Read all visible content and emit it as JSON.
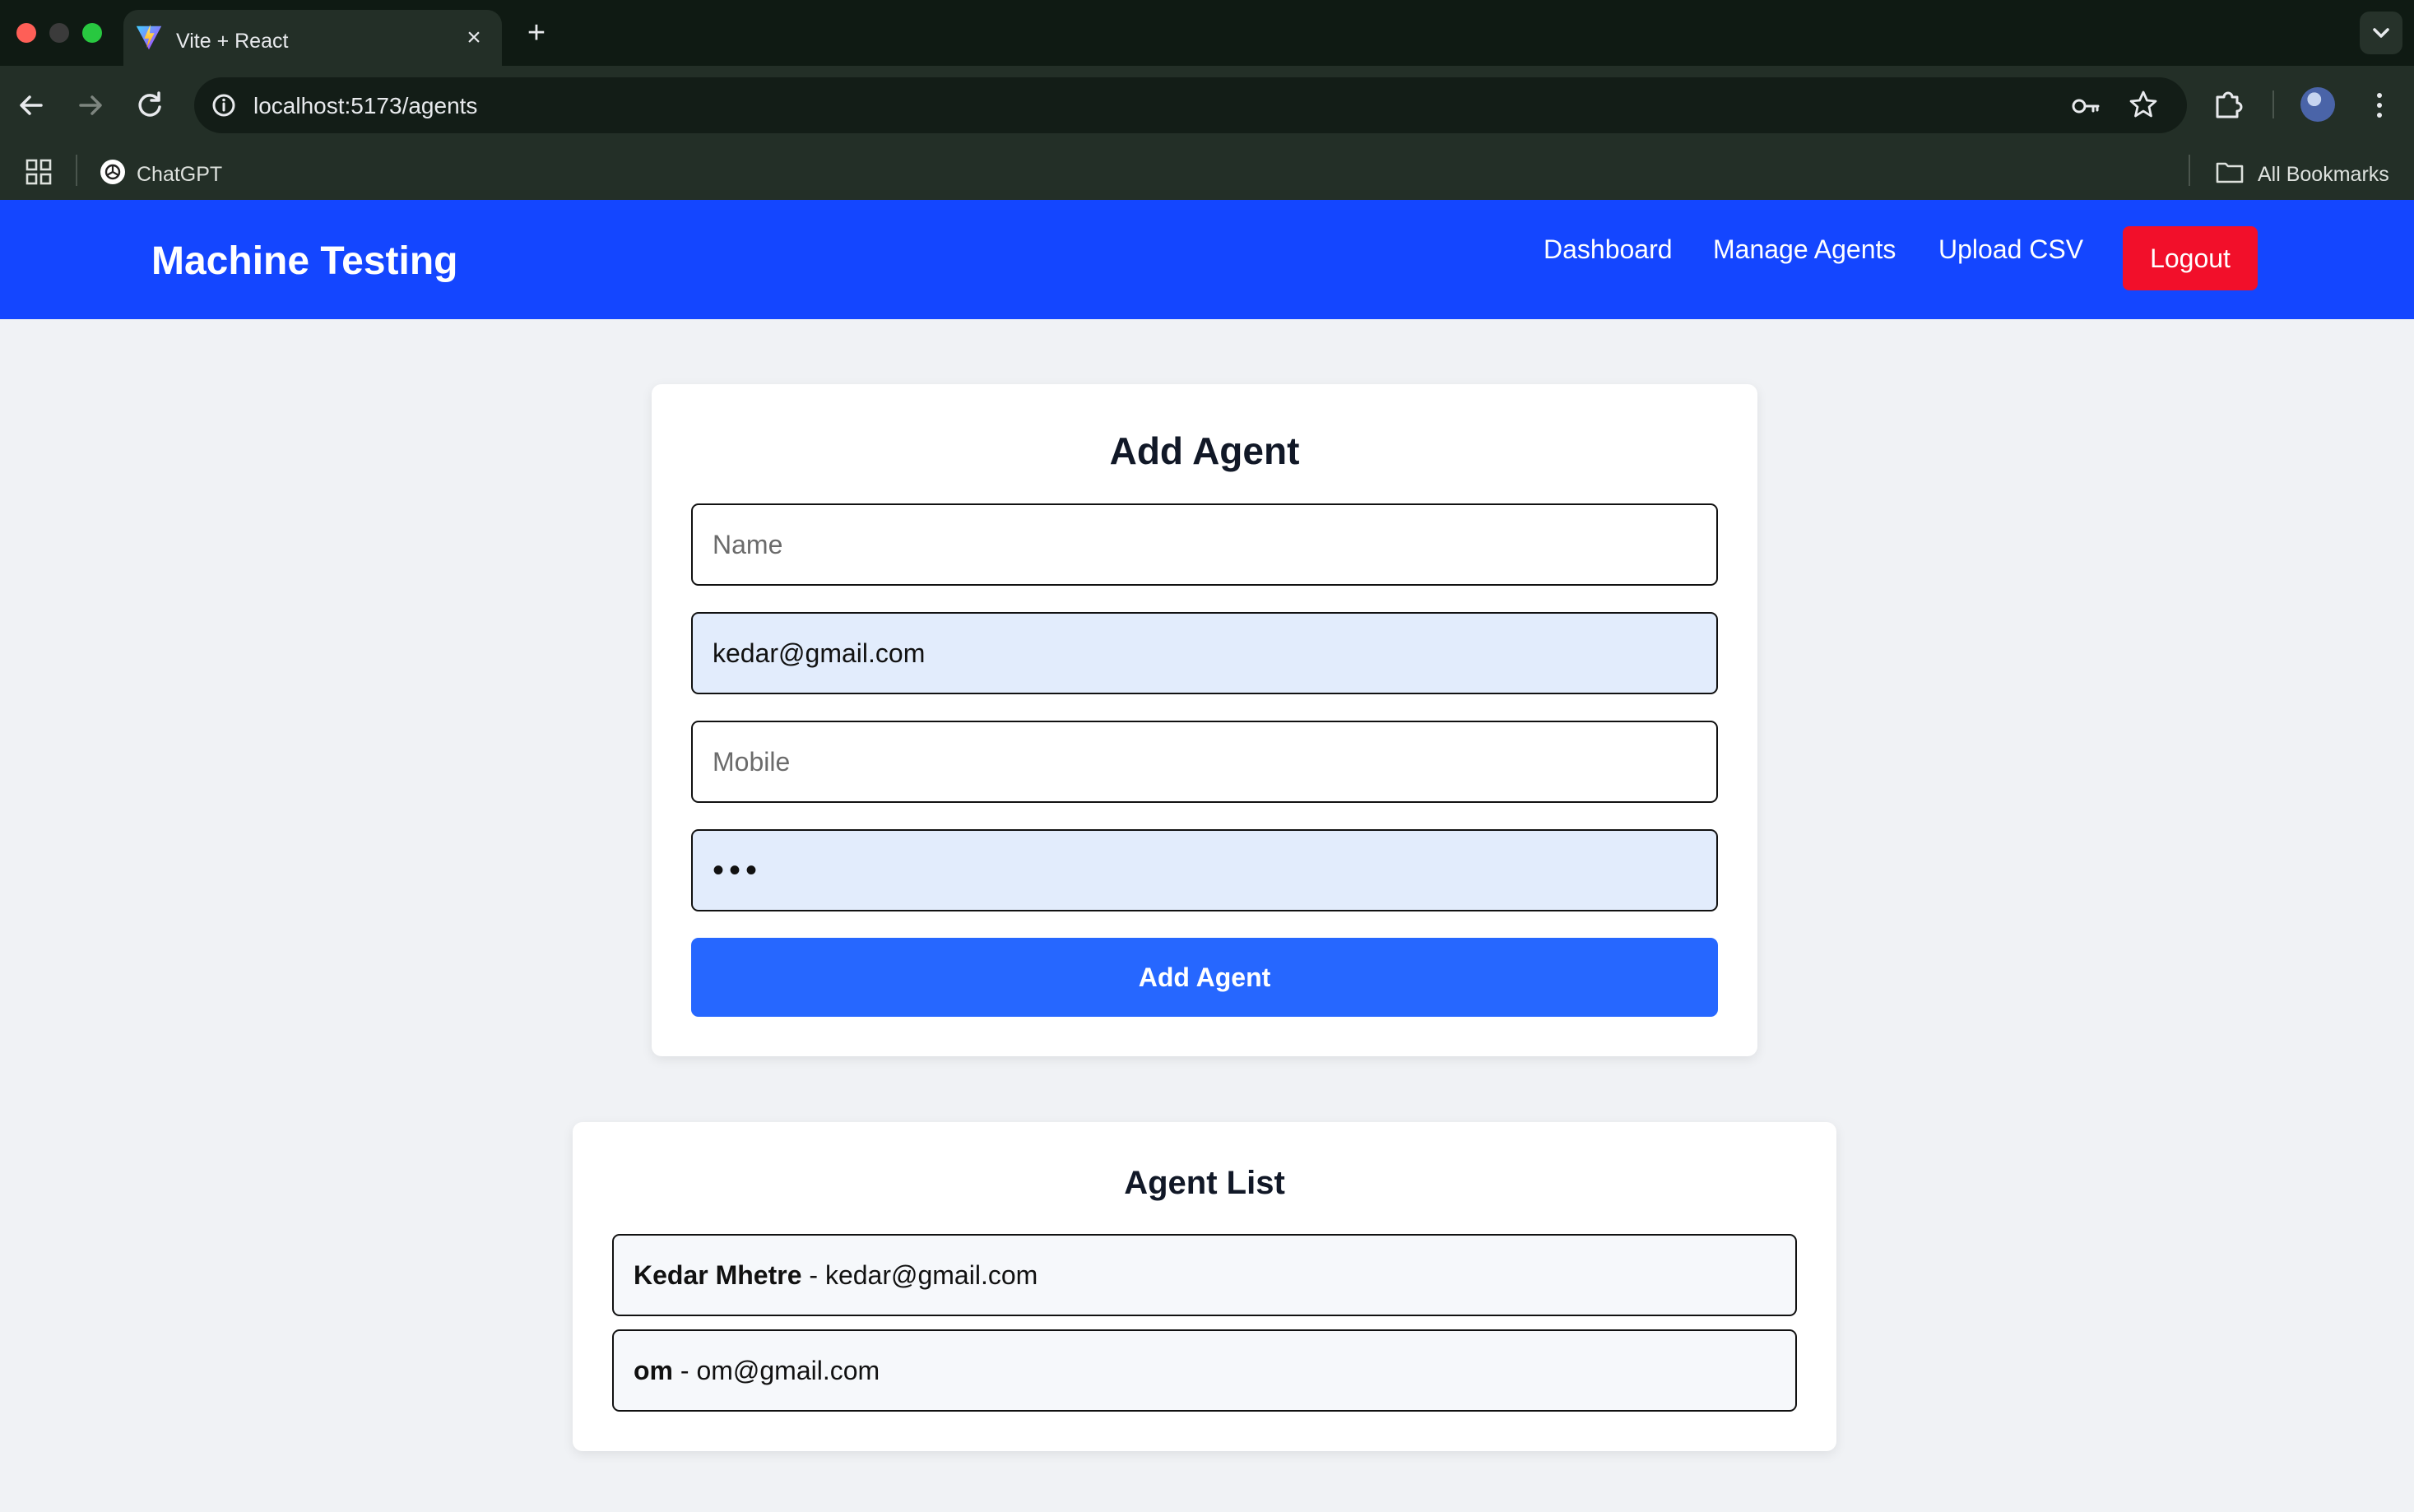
{
  "browser": {
    "tab_title": "Vite + React",
    "tab_close": "×",
    "new_tab": "+",
    "url": "localhost:5173/agents",
    "bookmarks": [
      {
        "label": "ChatGPT"
      }
    ],
    "all_bookmarks": "All Bookmarks"
  },
  "navbar": {
    "brand": "Machine Testing",
    "links": [
      "Dashboard",
      "Manage Agents",
      "Upload CSV"
    ],
    "logout": "Logout",
    "bg_color": "#1446ff",
    "logout_color": "#f20f2a"
  },
  "add_agent": {
    "title": "Add Agent",
    "name_placeholder": "Name",
    "email_value": "kedar@gmail.com",
    "mobile_placeholder": "Mobile",
    "password_value": "•••",
    "submit_label": "Add Agent",
    "button_color": "#2667ff"
  },
  "agent_list": {
    "title": "Agent List",
    "separator": " - ",
    "agents": [
      {
        "name": "Kedar Mhetre",
        "email": "kedar@gmail.com"
      },
      {
        "name": "om",
        "email": "om@gmail.com"
      }
    ]
  }
}
